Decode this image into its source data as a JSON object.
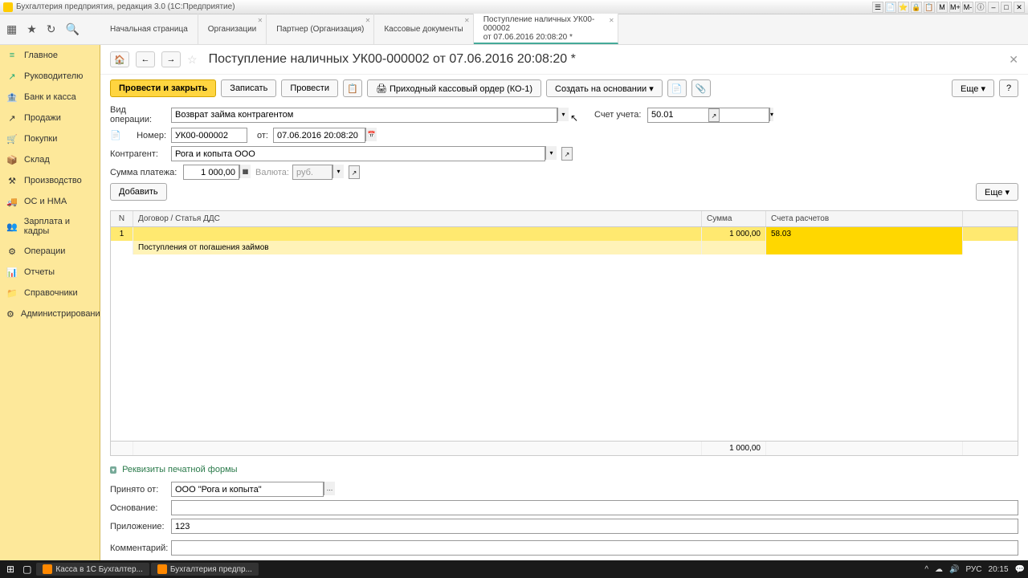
{
  "window": {
    "title": "Бухгалтерия предприятия, редакция 3.0 (1С:Предприятие)",
    "buttons": [
      "М",
      "М+",
      "М-"
    ]
  },
  "tabs": [
    {
      "label": "Начальная страница"
    },
    {
      "label": "Организации"
    },
    {
      "label": "Партнер (Организация)"
    },
    {
      "label": "Кассовые документы"
    },
    {
      "label": "Поступление наличных УК00-000002",
      "sublabel": "от 07.06.2016 20:08:20 *",
      "active": true
    }
  ],
  "sidebar": [
    {
      "icon": "≡",
      "label": "Главное",
      "color": "#2a7"
    },
    {
      "icon": "📊",
      "label": "Руководителю",
      "color": "#2a7"
    },
    {
      "icon": "🏦",
      "label": "Банк и касса",
      "color": "#888"
    },
    {
      "icon": "📈",
      "label": "Продажи",
      "color": "#888"
    },
    {
      "icon": "🛒",
      "label": "Покупки",
      "color": "#2a7"
    },
    {
      "icon": "📦",
      "label": "Склад",
      "color": "#888"
    },
    {
      "icon": "🏭",
      "label": "Производство",
      "color": "#888"
    },
    {
      "icon": "🚚",
      "label": "ОС и НМА",
      "color": "#888"
    },
    {
      "icon": "👥",
      "label": "Зарплата и кадры",
      "color": "#888"
    },
    {
      "icon": "⚙",
      "label": "Операции",
      "color": "#888"
    },
    {
      "icon": "📊",
      "label": "Отчеты",
      "color": "#888"
    },
    {
      "icon": "📁",
      "label": "Справочники",
      "color": "#888"
    },
    {
      "icon": "⚙",
      "label": "Администрирование",
      "color": "#888"
    }
  ],
  "doc": {
    "title": "Поступление наличных УК00-000002 от 07.06.2016 20:08:20 *",
    "actions": {
      "post_close": "Провести и закрыть",
      "save": "Записать",
      "post": "Провести",
      "print_order": "Приходный кассовый ордер (КО-1)",
      "create_based": "Создать на основании",
      "more": "Еще"
    },
    "fields": {
      "operation_type_label": "Вид операции:",
      "operation_type": "Возврат займа контрагентом",
      "account_label": "Счет учета:",
      "account": "50.01",
      "number_label": "Номер:",
      "number": "УК00-000002",
      "date_label": "от:",
      "date": "07.06.2016 20:08:20",
      "counterparty_label": "Контрагент:",
      "counterparty": "Рога и копыта ООО",
      "amount_label": "Сумма платежа:",
      "amount": "1 000,00",
      "currency_label": "Валюта:",
      "currency": "руб.",
      "add_btn": "Добавить",
      "more_btn": "Еще"
    },
    "table": {
      "headers": {
        "n": "N",
        "contract": "Договор / Статья ДДС",
        "sum": "Сумма",
        "accounts": "Счета расчетов"
      },
      "rows": [
        {
          "n": "1",
          "contract": "",
          "sum": "1 000,00",
          "account": "58.03"
        },
        {
          "n": "",
          "contract": "Поступления от погашения займов",
          "sum": "",
          "account": ""
        }
      ],
      "footer_sum": "1 000,00"
    },
    "print_section": {
      "title": "Реквизиты печатной формы",
      "received_from_label": "Принято от:",
      "received_from": "ООО \"Рога и копыта\"",
      "basis_label": "Основание:",
      "basis": "",
      "attachment_label": "Приложение:",
      "attachment": "123",
      "comment_label": "Комментарий:",
      "comment": ""
    }
  },
  "taskbar": {
    "items": [
      "Касса в 1С Бухгалтер...",
      "Бухгалтерия предпр..."
    ],
    "lang": "РУС",
    "time": "20:15"
  }
}
